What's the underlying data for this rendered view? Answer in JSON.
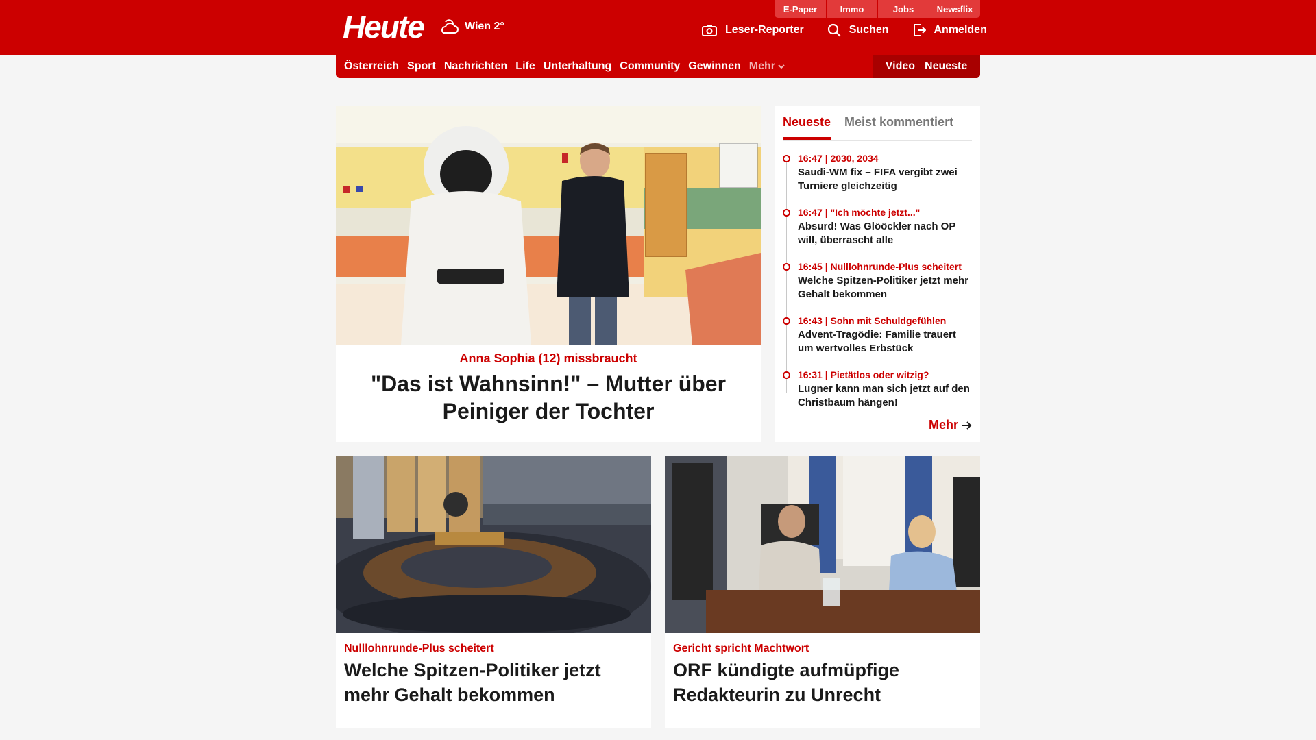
{
  "header": {
    "logo": "Heute",
    "weather": "Wien 2°",
    "toplinks": [
      "E-Paper",
      "Immo",
      "Jobs",
      "Newsflix"
    ],
    "actions": {
      "reporter": "Leser-Reporter",
      "search": "Suchen",
      "login": "Anmelden"
    }
  },
  "nav": {
    "items": [
      "Österreich",
      "Sport",
      "Nachrichten",
      "Life",
      "Unterhaltung",
      "Community",
      "Gewinnen"
    ],
    "more": "Mehr",
    "video": "Video",
    "latest": "Neueste"
  },
  "hero": {
    "kicker": "Anna Sophia (12) missbraucht",
    "title": "\"Das ist Wahnsinn!\" – Mutter über Peiniger der Tochter"
  },
  "sidebar": {
    "tabs": [
      "Neueste",
      "Meist kommentiert"
    ],
    "items": [
      {
        "meta": "16:47 | 2030, 2034",
        "title": "Saudi-WM fix – FIFA vergibt zwei Turniere gleichzeitig"
      },
      {
        "meta": "16:47 | \"Ich möchte jetzt...\"",
        "title": "Absurd! Was Glööckler nach OP will, überrascht alle"
      },
      {
        "meta": "16:45 | Nulllohnrunde-Plus scheitert",
        "title": "Welche Spitzen-Politiker jetzt mehr Gehalt bekommen"
      },
      {
        "meta": "16:43 | Sohn mit Schuldgefühlen",
        "title": "Advent-Tragödie: Familie trauert um wertvolles Erbstück"
      },
      {
        "meta": "16:31 | Pietätlos oder witzig?",
        "title": "Lugner kann man sich jetzt auf den Christbaum hängen!"
      }
    ],
    "more": "Mehr"
  },
  "cards": [
    {
      "kicker": "Nulllohnrunde-Plus scheitert",
      "title": "Welche Spitzen-Politiker jetzt mehr Gehalt bekommen"
    },
    {
      "kicker": "Gericht spricht Machtwort",
      "title": "ORF kündigte aufmüpfige Redakteurin zu Unrecht"
    }
  ],
  "colors": {
    "brand": "#cc0000",
    "brand_dark": "#a80000",
    "background": "#f5f5f5"
  }
}
